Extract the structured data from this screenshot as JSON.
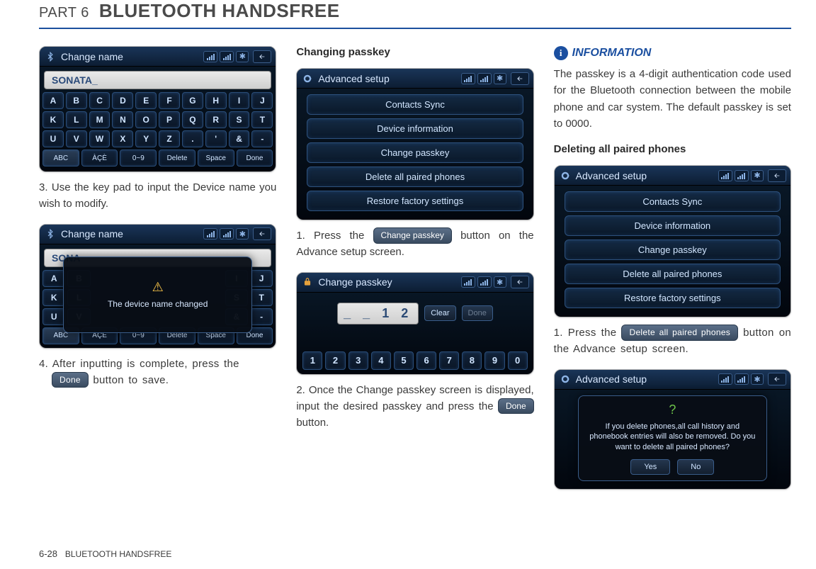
{
  "header": {
    "part_label": "PART 6",
    "title": "BLUETOOTH HANDSFREE"
  },
  "footer": {
    "page": "6-28",
    "section": "BLUETOOTH HANDSFREE"
  },
  "col1": {
    "shot1": {
      "title": "Change name",
      "input": "SONATA_",
      "keys_r1": [
        "A",
        "B",
        "C",
        "D",
        "E",
        "F",
        "G",
        "H",
        "I",
        "J"
      ],
      "keys_r2": [
        "K",
        "L",
        "M",
        "N",
        "O",
        "P",
        "Q",
        "R",
        "S",
        "T"
      ],
      "keys_r3": [
        "U",
        "V",
        "W",
        "X",
        "Y",
        "Z",
        ".",
        "'",
        "&",
        "-"
      ],
      "keys_r4": [
        "ABC",
        "ÀÇÈ",
        "0~9",
        "Delete",
        "Space",
        "Done"
      ]
    },
    "step3": "3. Use the key pad to input the Device name you wish to modify.",
    "shot2": {
      "title": "Change name",
      "input": "SONA",
      "overlay_msg": "The device name changed",
      "keys_r1": [
        "A",
        "B",
        "I",
        "J"
      ],
      "keys_r2": [
        "K",
        "L",
        "S",
        "T"
      ],
      "keys_r3": [
        "U",
        "V",
        "&",
        "-"
      ],
      "keys_r4": [
        "ABC",
        "ÀÇÈ",
        "0~9",
        "Delete",
        "Space",
        "Done"
      ]
    },
    "step4_a": "4. After inputting is complete, press the ",
    "step4_btn": "Done",
    "step4_b": " button to save."
  },
  "col2": {
    "head1": "Changing passkey",
    "shot1": {
      "title": "Advanced setup",
      "items": [
        "Contacts Sync",
        "Device information",
        "Change passkey",
        "Delete all paired phones",
        "Restore factory settings"
      ]
    },
    "step1_a": "1. Press the ",
    "step1_btn": "Change passkey",
    "step1_b": " button on the Advance setup screen.",
    "shot2": {
      "title": "Change passkey",
      "digits": "_ _ 1 2",
      "clear": "Clear",
      "done": "Done",
      "nums": [
        "1",
        "2",
        "3",
        "4",
        "5",
        "6",
        "7",
        "8",
        "9",
        "0"
      ]
    },
    "step2_a": "2. Once the Change passkey screen is displa­yed, input the desired passkey and press the ",
    "step2_btn": "Done",
    "step2_b": " button."
  },
  "col3": {
    "info_label": "INFORMATION",
    "info_text": "The passkey is a 4-digit authentication code used for the Bluetooth connection between the mobile phone and car system. The default passkey is set to 0000.",
    "head2": "Deleting all paired phones",
    "shot1": {
      "title": "Advanced setup",
      "items": [
        "Contacts Sync",
        "Device information",
        "Change passkey",
        "Delete all paired phones",
        "Restore factory settings"
      ]
    },
    "step1_a": "1. Press the ",
    "step1_btn": "Delete all paired phones",
    "step1_b": " button on the Advance setup screen.",
    "shot2": {
      "title": "Advanced setup",
      "overlay_msg": "If you delete phones,all call history and phonebook entries will also be removed. Do you want to delete all paired phones?",
      "yes": "Yes",
      "no": "No"
    }
  }
}
